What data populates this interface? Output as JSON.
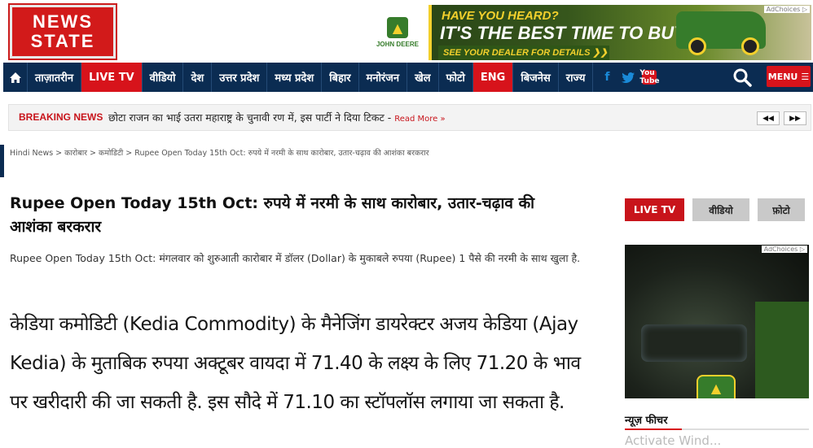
{
  "logo": {
    "line1": "NEWS",
    "line2": "STATE"
  },
  "top_ad": {
    "brand": "JOHN DEERE",
    "line1": "HAVE YOU HEARD?",
    "line2": "IT'S THE BEST TIME TO BUY",
    "line3": "SEE YOUR DEALER FOR DETAILS ❯❯",
    "adchoices": "AdChoices ▷"
  },
  "nav": {
    "items": [
      "ताज़ातरीन",
      "LIVE TV",
      "वीडियो",
      "देश",
      "उत्तर प्रदेश",
      "मध्य प्रदेश",
      "बिहार",
      "मनोरंजन",
      "खेल",
      "फोटो",
      "ENG",
      "बिजनेस",
      "राज्य"
    ],
    "menu_label": "MENU",
    "social": {
      "facebook": "f",
      "twitter": "t",
      "youtube": "You Tube"
    }
  },
  "breaking": {
    "label": "BREAKING NEWS",
    "text": "छोटा राजन का भाई उतरा महाराष्ट्र के चुनावी रण में, इस पार्टी ने दिया टिकट -",
    "more": "Read More »",
    "prev": "◀◀",
    "next": "▶▶"
  },
  "breadcrumb": "Hindi News > कारोबार > कमोडिटी > Rupee Open Today 15th Oct: रुपये में नरमी के साथ कारोबार, उतार-चढ़ाव की आशंका बरकरार",
  "article": {
    "headline": "Rupee Open Today 15th Oct: रुपये में नरमी के साथ कारोबार, उतार-चढ़ाव की आशंका बरकरार",
    "summary": "Rupee Open Today 15th Oct: मंगलवार को शुरुआती कारोबार में डॉलर (Dollar) के मुकाबले रुपया (Rupee) 1 पैसे की नरमी के साथ खुला है.",
    "body": "केडिया कमोडिटी (Kedia Commodity) के मैनेजिंग डायरेक्टर अजय केडिया (Ajay Kedia) के मुताबिक रुपया अक्टूबर वायदा में 71.40 के लक्ष्य के लिए 71.20 के भाव पर खरीदारी की जा सकती है. इस सौदे में 71.10 का स्टॉपलॉस लगाया जा सकता है."
  },
  "sidebar": {
    "tabs": [
      "LIVE TV",
      "वीडियो",
      "फ़ोटो"
    ],
    "ad_choices": "AdChoices ▷",
    "feature_title": "न्यूज़ फीचर",
    "feature_cut": "Activate Wind..."
  },
  "colors": {
    "brand_red": "#d7131b",
    "nav_blue": "#0b2c52",
    "john_deere_green": "#367c2b",
    "john_deere_yellow": "#f3d02c"
  }
}
